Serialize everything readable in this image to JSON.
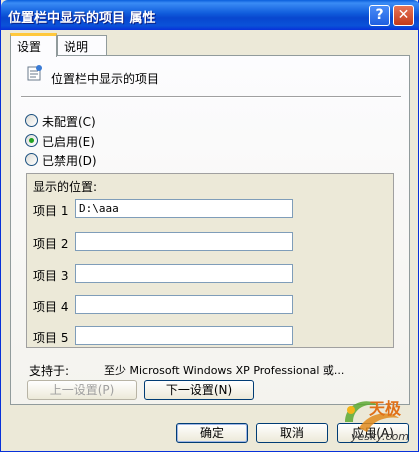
{
  "window": {
    "title": "位置栏中显示的项目 属性",
    "help_glyph": "?",
    "close_glyph": "✕"
  },
  "tabs": [
    {
      "label": "设置"
    },
    {
      "label": "说明"
    }
  ],
  "policy": {
    "icon": "policy-setting-icon",
    "name": "位置栏中显示的项目"
  },
  "radios": {
    "not_configured": "未配置(C)",
    "enabled": "已启用(E)",
    "disabled": "已禁用(D)",
    "selected": "enabled"
  },
  "options": {
    "title": "显示的位置:",
    "items": [
      {
        "label": "项目 1",
        "value": "D:\\aaa"
      },
      {
        "label": "项目 2",
        "value": ""
      },
      {
        "label": "项目 3",
        "value": ""
      },
      {
        "label": "项目 4",
        "value": ""
      },
      {
        "label": "项目 5",
        "value": ""
      }
    ]
  },
  "supported": {
    "label": "支持于:",
    "value": "至少 Microsoft Windows XP Professional 或..."
  },
  "nav": {
    "prev": "上一设置(P)",
    "next": "下一设置(N)"
  },
  "footer": {
    "ok": "确定",
    "cancel": "取消",
    "apply": "应用(A)"
  },
  "watermark": {
    "brand": "天极",
    "site": "yesky.com"
  }
}
